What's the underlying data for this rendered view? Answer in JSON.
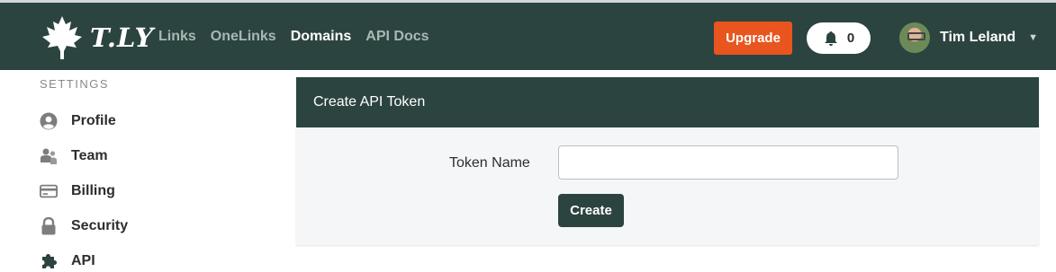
{
  "brand": {
    "name": "T.LY"
  },
  "nav": {
    "links": [
      {
        "label": "Links",
        "active": false
      },
      {
        "label": "OneLinks",
        "active": false
      },
      {
        "label": "Domains",
        "active": true
      },
      {
        "label": "API Docs",
        "active": false
      }
    ]
  },
  "header": {
    "upgrade_label": "Upgrade",
    "notification_count": "0",
    "user_name": "Tim Leland"
  },
  "sidebar": {
    "title": "SETTINGS",
    "items": [
      {
        "label": "Profile",
        "icon": "user-circle-icon"
      },
      {
        "label": "Team",
        "icon": "users-icon"
      },
      {
        "label": "Billing",
        "icon": "credit-card-icon"
      },
      {
        "label": "Security",
        "icon": "lock-icon"
      },
      {
        "label": "API",
        "icon": "puzzle-icon"
      }
    ]
  },
  "card": {
    "title": "Create API Token",
    "field_label": "Token Name",
    "field_value": "",
    "submit_label": "Create"
  },
  "colors": {
    "brand_dark": "#2c4440",
    "accent_orange": "#e8551f"
  }
}
